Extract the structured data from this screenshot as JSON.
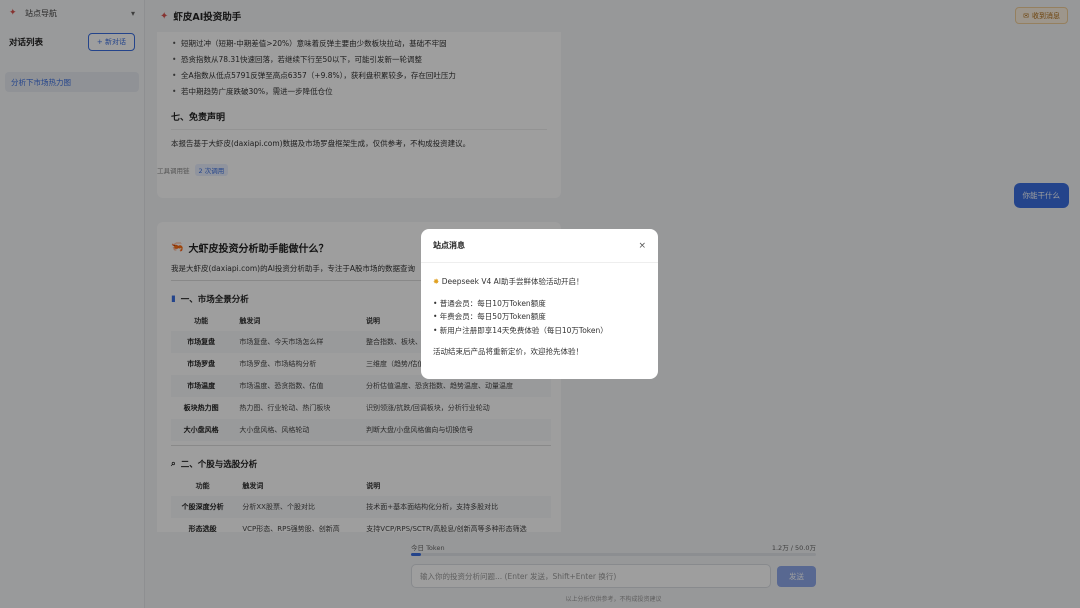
{
  "sidebar": {
    "nav_label": "站点导航",
    "nav_chevron": "▾",
    "conversations_title": "对话列表",
    "new_chat_label": "+ 新对话",
    "conversations": [
      "分析下市场热力图"
    ]
  },
  "header": {
    "title": "虾皮AI投资助手",
    "inbox_label": "收到消息"
  },
  "card1": {
    "bullets": [
      "短期过冲（短期-中期差值>20%）意味着反弹主要由少数板块拉动，基础不牢固",
      "恐贪指数从78.31快速回落，若继续下行至50以下，可能引发新一轮调整",
      "全A指数从低点5791反弹至高点6357（+9.8%），获利盘积累较多，存在回吐压力",
      "若中期趋势广度跌破30%，需进一步降低仓位"
    ],
    "disclaimer_heading": "七、免责声明",
    "disclaimer_text": "本报告基于大虾皮(daxiapi.com)数据及市场罗盘框架生成，仅供参考，不构成投资建议。"
  },
  "tool_call": {
    "label": "工具调用链",
    "badge": "2 次调用"
  },
  "user_message": "你能干什么",
  "card2": {
    "title": "大虾皮投资分析助手能做什么？",
    "intro": "我是大虾皮(daxiapi.com)的AI投资分析助手，专注于A股市场的数据查询",
    "section1_title": "一、市场全景分析",
    "table1_headers": [
      "功能",
      "触发词",
      "说明"
    ],
    "table1_rows": [
      [
        "市场复盘",
        "市场复盘、今天市场怎么样",
        "整合指数、板块、涨跌"
      ],
      [
        "市场罗盘",
        "市场罗盘、市场结构分析",
        "三维度（趋势/估值/情绪"
      ],
      [
        "市场温度",
        "市场温度、恐贪指数、估值",
        "分析估值温度、恐贪指数、趋势温度、动量温度"
      ],
      [
        "板块热力图",
        "热力图、行业轮动、热门板块",
        "识别领涨/抗跌/回调板块，分析行业轮动"
      ],
      [
        "大小盘风格",
        "大小盘风格、风格轮动",
        "判断大盘/小盘风格偏向与切换信号"
      ]
    ],
    "section2_title": "二、个股与选股分析",
    "table2_headers": [
      "功能",
      "触发词",
      "说明"
    ],
    "table2_rows": [
      [
        "个股深度分析",
        "分析XX股票、个股对比",
        "技术面+基本面结构化分析，支持多股对比"
      ],
      [
        "形态选股",
        "VCP形态、RPS强势股、创新高",
        "支持VCP/RPS/SCTR/高股息/创新高等多种形态筛选"
      ]
    ]
  },
  "bottom": {
    "token_label": "今日 Token",
    "token_usage": "1.2万 / 50.0万",
    "token_fraction": 0.024,
    "input_placeholder": "输入你的投资分析问题... (Enter 发送，Shift+Enter 换行)",
    "send_label": "发送",
    "disclaimer": "以上分析仅供参考，不构成投资建议"
  },
  "modal": {
    "title": "站点消息",
    "close": "×",
    "headline": "Deepseek V4 AI助手尝鲜体验活动开启！",
    "lines": [
      "• 普通会员：每日10万Token额度",
      "• 年费会员：每日50万Token额度",
      "• 新用户注册即享14天免费体验（每日10万Token）"
    ],
    "footer": "活动结束后产品将重新定价，欢迎抢先体验！"
  },
  "colors": {
    "accent": "#3b6fe0",
    "brand": "#d9534f",
    "inbox": "#b06a10"
  }
}
